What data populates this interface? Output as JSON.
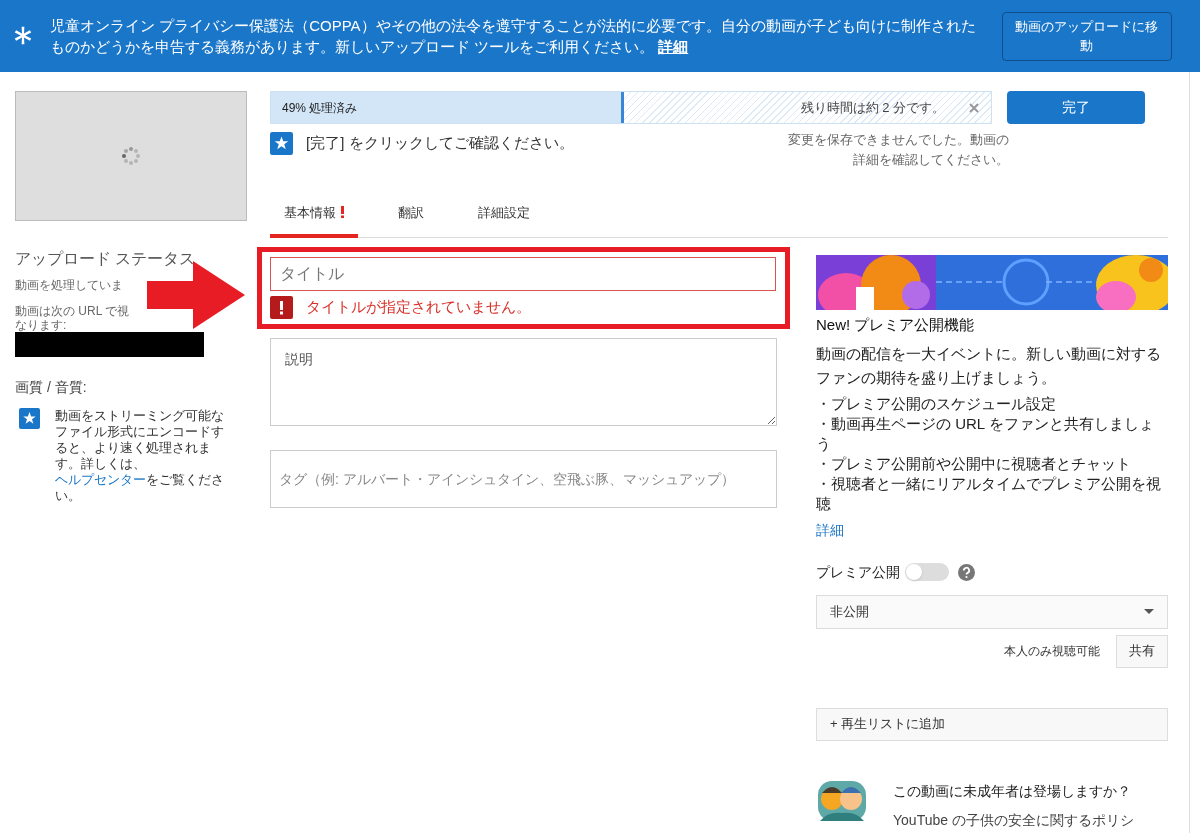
{
  "banner": {
    "text": "児童オンライン プライバシー保護法（COPPA）やその他の法令を遵守することが法的に必要です。自分の動画が子ども向けに制作されたものかどうかを申告する義務があります。新しいアップロード ツールをご利用ください。",
    "link": "詳細",
    "button": "動画のアップロードに移動"
  },
  "upload_status": {
    "heading": "アップロード ステータス",
    "lines": [
      "動画を処理していま",
      "動画は次の URL で視",
      "なります:"
    ]
  },
  "quality": {
    "heading": "画質 / 音質:",
    "note": "動画をストリーミング可能なファイル形式にエンコードすると、より速く処理されます。詳しくは、",
    "link": "ヘルプセンター",
    "note_end": "をご覧ください。"
  },
  "progress": {
    "label": "49% 処理済み",
    "level": 0.49,
    "remaining": "残り時間は約 2 分です。"
  },
  "done_button": "完了",
  "save_error": "変更を保存できませんでした。動画の詳細を確認してください。",
  "notice": "[完了] をクリックしてご確認ください。",
  "tabs": [
    {
      "label": "基本情報",
      "selected": true,
      "error": true
    },
    {
      "label": "翻訳",
      "selected": false,
      "error": false
    },
    {
      "label": "詳細設定",
      "selected": false,
      "error": false
    }
  ],
  "title_field": {
    "placeholder": "タイトル",
    "error": "タイトルが指定されていません。"
  },
  "description_field": {
    "placeholder": "説明"
  },
  "tags_field": {
    "placeholder": "タグ（例: アルバート・アインシュタイン、空飛ぶ豚、マッシュアップ）"
  },
  "promo": {
    "title": "New! プレミア公開機能",
    "body": "動画の配信を一大イベントに。新しい動画に対するファンの期待を盛り上げましょう。",
    "bullets": [
      "・プレミア公開のスケジュール設定",
      "・動画再生ページの URL をファンと共有しましょう",
      "・プレミア公開前や公開中に視聴者とチャット",
      "・視聴者と一緒にリアルタイムでプレミア公開を視聴"
    ],
    "link": "詳細"
  },
  "premiere": {
    "label": "プレミア公開",
    "on": false
  },
  "visibility": {
    "value": "非公開",
    "note": "本人のみ視聴可能",
    "share_button": "共有"
  },
  "playlist_button": "+ 再生リストに追加",
  "minors": {
    "question": "この動画に未成年者は登場しますか？",
    "text": "YouTube の子供の安全に関するポリシ"
  }
}
